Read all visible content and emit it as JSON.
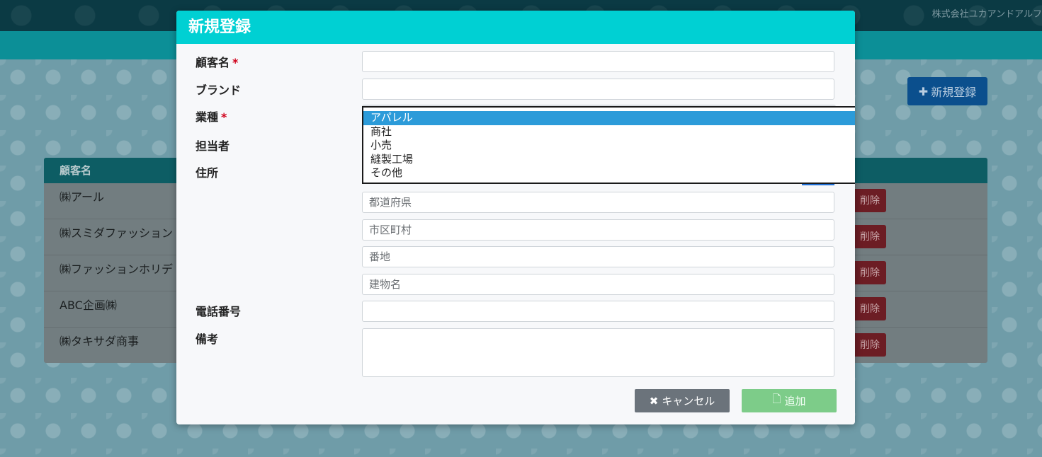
{
  "header": {
    "company_name": "株式会社ユカアンドアルフ"
  },
  "page": {
    "new_button_icon": "plus-icon",
    "new_button_label": "新規登録",
    "table": {
      "column_header": "顧客名",
      "delete_label": "削除",
      "rows": [
        {
          "name": "㈱アール"
        },
        {
          "name": "㈱スミダファッション"
        },
        {
          "name": "㈱ファッションホリデ"
        },
        {
          "name": "ABC企画㈱"
        },
        {
          "name": "㈱タキサダ商事"
        }
      ]
    }
  },
  "modal": {
    "title": "新規登録",
    "fields": {
      "customer_name": {
        "label": "顧客名",
        "required_mark": "*",
        "value": ""
      },
      "brand": {
        "label": "ブランド",
        "value": ""
      },
      "industry": {
        "label": "業種",
        "required_mark": "*",
        "options": [
          "アパレル",
          "商社",
          "小売",
          "縫製工場",
          "その他"
        ],
        "highlighted": "アパレル"
      },
      "person": {
        "label": "担当者"
      },
      "address": {
        "label": "住所",
        "prefecture_placeholder": "都道府県",
        "city_placeholder": "市区町村",
        "street_placeholder": "番地",
        "building_placeholder": "建物名"
      },
      "phone": {
        "label": "電話番号",
        "value": ""
      },
      "notes": {
        "label": "備考",
        "value": ""
      }
    },
    "buttons": {
      "cancel_icon": "times-icon",
      "cancel_label": "キャンセル",
      "add_icon": "file-icon",
      "add_label": "追加"
    }
  },
  "colors": {
    "modal_header": "#00d0d3",
    "selected_option": "#2c9bd9",
    "cancel_button": "#6b737b",
    "add_button": "#7dcc89"
  }
}
